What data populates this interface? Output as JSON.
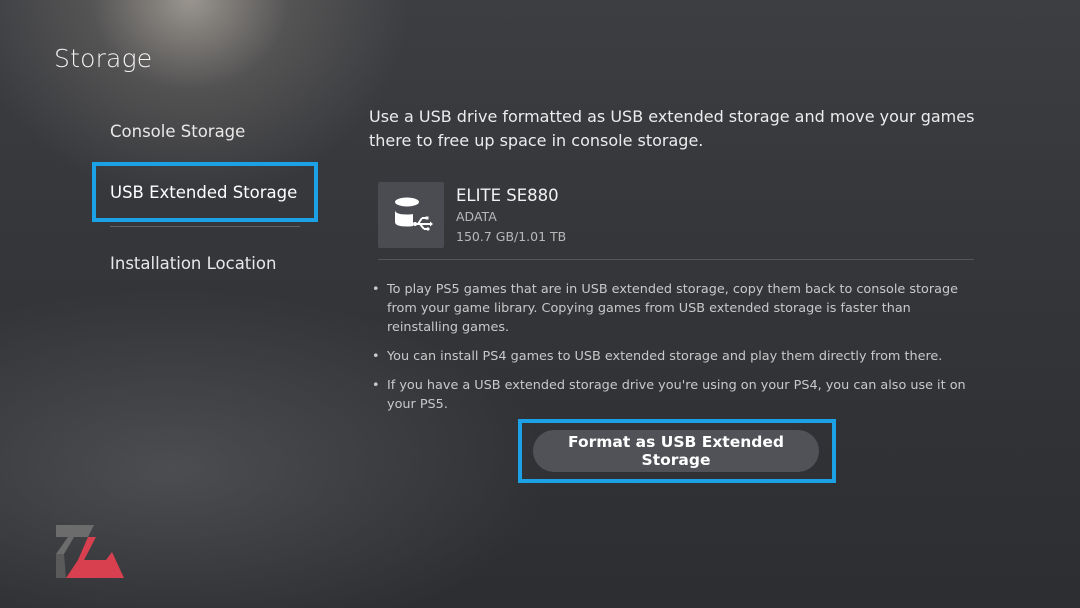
{
  "header": {
    "title": "Storage"
  },
  "sidebar": {
    "items": [
      {
        "label": "Console Storage"
      },
      {
        "label": "USB Extended Storage",
        "selected": true
      },
      {
        "label": "Installation Location"
      }
    ]
  },
  "main": {
    "description": "Use a USB drive formatted as USB extended storage and move your games there to free up space in console storage.",
    "device": {
      "icon": "usb-drive-icon",
      "name": "ELITE SE880",
      "brand": "ADATA",
      "capacity": "150.7 GB/1.01 TB"
    },
    "notes": [
      "To play PS5 games that are in USB extended storage, copy them back to console storage from your game library. Copying games from USB extended storage is faster than reinstalling games.",
      "You can install PS4 games to USB extended storage and play them directly from there.",
      "If you have a USB extended storage drive you're using on your PS4, you can also use it on your PS5."
    ],
    "bullet": "•",
    "format_button": "Format as USB Extended Storage"
  },
  "colors": {
    "focus": "#1da1e6",
    "button_bg": "#505257",
    "logo_red": "#d8404f",
    "logo_gray": "#6c6c6c"
  }
}
